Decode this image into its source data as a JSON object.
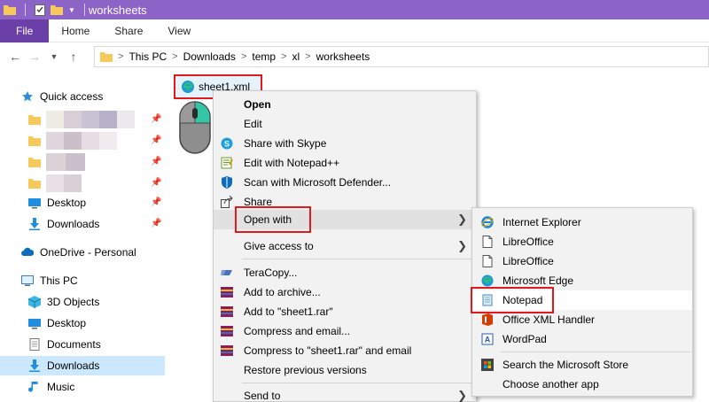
{
  "window": {
    "title": "worksheets",
    "accent": "#8c64c8"
  },
  "ribbon": {
    "tabs": [
      {
        "label": "File"
      },
      {
        "label": "Home"
      },
      {
        "label": "Share"
      },
      {
        "label": "View"
      }
    ]
  },
  "address": {
    "crumbs": [
      "This PC",
      "Downloads",
      "temp",
      "xl",
      "worksheets"
    ]
  },
  "nav": {
    "quick_access": "Quick access",
    "desktop": "Desktop",
    "downloads": "Downloads",
    "onedrive": "OneDrive - Personal",
    "this_pc": "This PC",
    "objects_3d": "3D Objects",
    "desktop2": "Desktop",
    "documents": "Documents",
    "downloads2": "Downloads",
    "music": "Music"
  },
  "file": {
    "name": "sheet1.xml"
  },
  "context_menu": {
    "items": [
      {
        "label": "Open"
      },
      {
        "label": "Edit"
      },
      {
        "label": "Share with Skype"
      },
      {
        "label": "Edit with Notepad++"
      },
      {
        "label": "Scan with Microsoft Defender..."
      },
      {
        "label": "Share"
      },
      {
        "label": "Open with"
      },
      {
        "label": "Give access to"
      },
      {
        "label": "TeraCopy..."
      },
      {
        "label": "Add to archive..."
      },
      {
        "label": "Add to \"sheet1.rar\""
      },
      {
        "label": "Compress and email..."
      },
      {
        "label": "Compress to \"sheet1.rar\" and email"
      },
      {
        "label": "Restore previous versions"
      },
      {
        "label": "Send to"
      }
    ]
  },
  "open_with": {
    "items": [
      {
        "label": "Internet Explorer"
      },
      {
        "label": "LibreOffice"
      },
      {
        "label": "LibreOffice"
      },
      {
        "label": "Microsoft Edge"
      },
      {
        "label": "Notepad"
      },
      {
        "label": "Office XML Handler"
      },
      {
        "label": "WordPad"
      },
      {
        "label": "Search the Microsoft Store"
      },
      {
        "label": "Choose another app"
      }
    ]
  },
  "highlight_color": "#e0191c"
}
